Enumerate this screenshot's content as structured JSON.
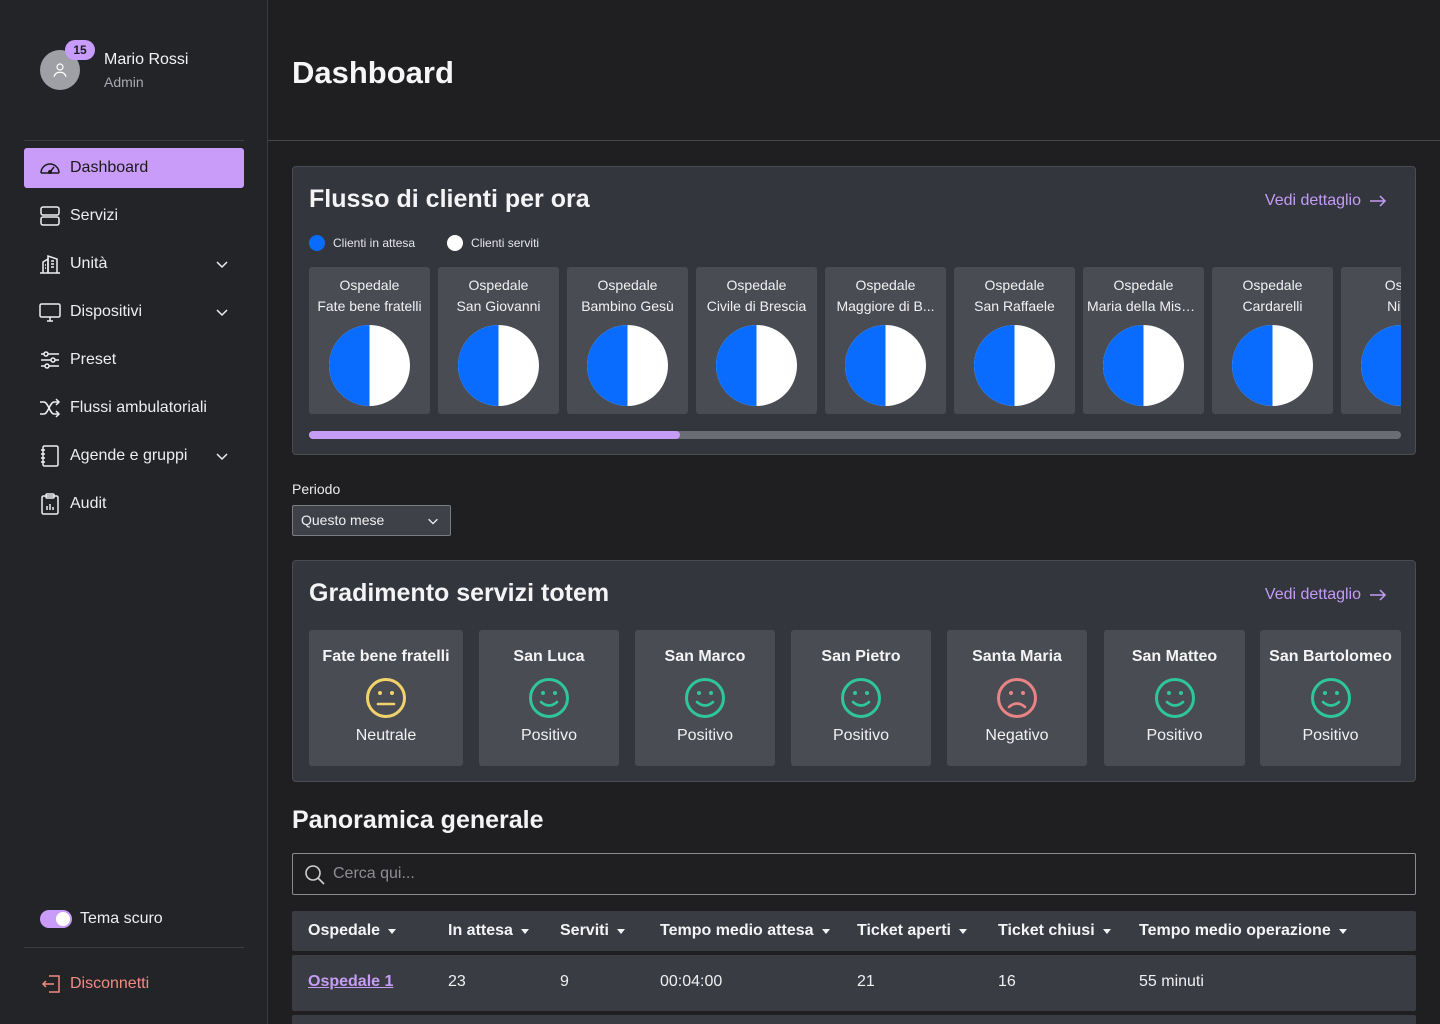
{
  "user": {
    "name": "Mario Rossi",
    "role": "Admin",
    "notifications": "15"
  },
  "sidebar": {
    "items": [
      {
        "label": "Dashboard",
        "icon": "speedometer-icon",
        "active": true
      },
      {
        "label": "Servizi",
        "icon": "server-icon"
      },
      {
        "label": "Unità",
        "icon": "building-icon",
        "expandable": true
      },
      {
        "label": "Dispositivi",
        "icon": "monitor-icon",
        "expandable": true
      },
      {
        "label": "Preset",
        "icon": "sliders-icon"
      },
      {
        "label": "Flussi ambulatoriali",
        "icon": "shuffle-icon"
      },
      {
        "label": "Agende e gruppi",
        "icon": "notebook-icon",
        "expandable": true
      },
      {
        "label": "Audit",
        "icon": "clipboard-chart-icon"
      }
    ],
    "theme_label": "Tema scuro",
    "theme_on": true,
    "logout_label": "Disconnetti"
  },
  "header": {
    "title": "Dashboard"
  },
  "flow": {
    "title": "Flusso di clienti per ora",
    "detail_label": "Vedi dettaglio",
    "legend": [
      {
        "label": "Clienti in attesa",
        "color": "#0a6cff"
      },
      {
        "label": "Clienti serviti",
        "color": "#ffffff"
      }
    ],
    "hospitals": [
      {
        "line1": "Ospedale",
        "line2": "Fate bene fratelli",
        "waiting_share": 0.5
      },
      {
        "line1": "Ospedale",
        "line2": "San Giovanni",
        "waiting_share": 0.5
      },
      {
        "line1": "Ospedale",
        "line2": "Bambino Gesù",
        "waiting_share": 0.5
      },
      {
        "line1": "Ospedale",
        "line2": "Civile di Brescia",
        "waiting_share": 0.5
      },
      {
        "line1": "Ospedale",
        "line2": "Maggiore di B...",
        "waiting_share": 0.5
      },
      {
        "line1": "Ospedale",
        "line2": "San Raffaele",
        "waiting_share": 0.5
      },
      {
        "line1": "Ospedale",
        "line2": "Maria della Miseric",
        "waiting_share": 0.5
      },
      {
        "line1": "Ospedale",
        "line2": "Cardarelli",
        "waiting_share": 0.5
      },
      {
        "line1": "Ospe",
        "line2": "Nigu",
        "waiting_share": 0.5
      }
    ],
    "scroll_fraction": 0.34
  },
  "period": {
    "label": "Periodo",
    "value": "Questo mese"
  },
  "ratings": {
    "title": "Gradimento servizi totem",
    "detail_label": "Vedi dettaglio",
    "items": [
      {
        "name": "Fate bene fratelli",
        "value": "Neutrale",
        "mood": "neutral",
        "color": "#f2d36b"
      },
      {
        "name": "San Luca",
        "value": "Positivo",
        "mood": "positive",
        "color": "#2ec79a"
      },
      {
        "name": "San Marco",
        "value": "Positivo",
        "mood": "positive",
        "color": "#2ec79a"
      },
      {
        "name": "San Pietro",
        "value": "Positivo",
        "mood": "positive",
        "color": "#2ec79a"
      },
      {
        "name": "Santa Maria",
        "value": "Negativo",
        "mood": "negative",
        "color": "#e98484"
      },
      {
        "name": "San Matteo",
        "value": "Positivo",
        "mood": "positive",
        "color": "#2ec79a"
      },
      {
        "name": "San Bartolomeo",
        "value": "Positivo",
        "mood": "positive",
        "color": "#2ec79a"
      }
    ]
  },
  "overview": {
    "title": "Panoramica generale",
    "search_placeholder": "Cerca qui...",
    "columns": [
      "Ospedale",
      "In attesa",
      "Serviti",
      "Tempo medio attesa",
      "Ticket aperti",
      "Ticket chiusi",
      "Tempo medio operazione"
    ],
    "rows": [
      [
        "Ospedale 1",
        "23",
        "9",
        "00:04:00",
        "21",
        "16",
        "55 minuti"
      ]
    ]
  },
  "colors": {
    "accent": "#c99cfa",
    "waiting": "#0a6cff",
    "served": "#ffffff"
  }
}
